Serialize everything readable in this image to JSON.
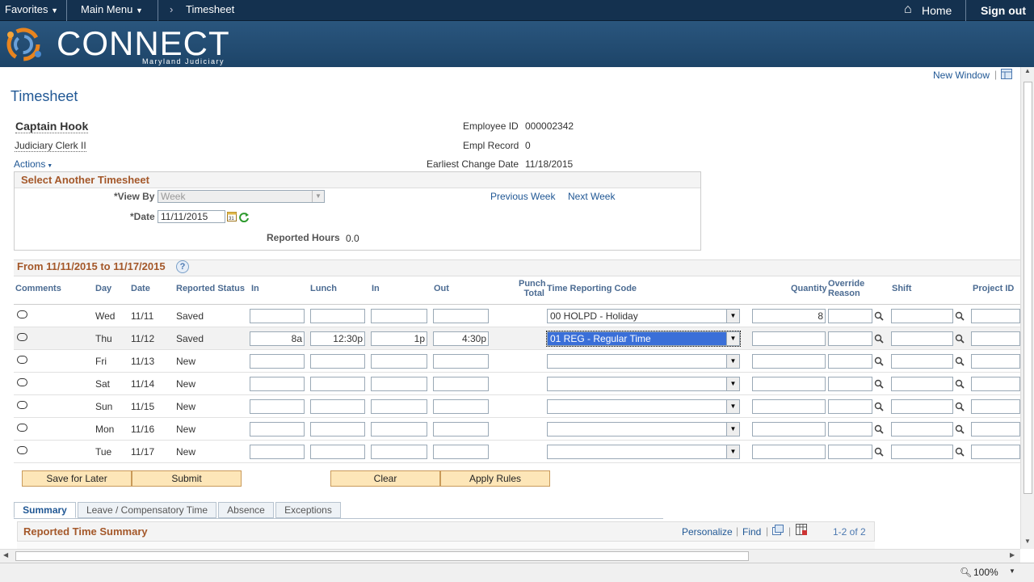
{
  "topnav": {
    "favorites": "Favorites",
    "main_menu": "Main Menu",
    "breadcrumb_current": "Timesheet",
    "home": "Home",
    "sign_out": "Sign out"
  },
  "banner": {
    "logo_title": "CONNECT",
    "logo_subtitle": "Maryland Judiciary"
  },
  "page": {
    "new_window": "New Window",
    "title": "Timesheet"
  },
  "employee": {
    "name": "Captain Hook",
    "job_title": "Judiciary Clerk II",
    "actions": "Actions",
    "employee_id_label": "Employee ID",
    "employee_id": "000002342",
    "empl_record_label": "Empl Record",
    "empl_record": "0",
    "earliest_change_label": "Earliest Change Date",
    "earliest_change": "11/18/2015"
  },
  "select_timesheet": {
    "header": "Select Another Timesheet",
    "view_by_label": "*View By",
    "view_by_value": "Week",
    "date_label": "*Date",
    "date_value": "11/11/2015",
    "previous_week": "Previous Week",
    "next_week": "Next Week",
    "reported_hours_label": "Reported Hours",
    "reported_hours": "0.0"
  },
  "grid": {
    "period": "From 11/11/2015 to 11/17/2015",
    "headers": {
      "comments": "Comments",
      "day": "Day",
      "date": "Date",
      "status": "Reported Status",
      "in1": "In",
      "lunch": "Lunch",
      "in2": "In",
      "out": "Out",
      "punch_total_1": "Punch",
      "punch_total_2": "Total",
      "trc": "Time Reporting Code",
      "quantity": "Quantity",
      "override_1": "Override",
      "override_2": "Reason",
      "shift": "Shift",
      "project": "Project ID"
    },
    "rows": [
      {
        "day": "Wed",
        "date": "11/11",
        "status": "Saved",
        "in1": "",
        "lunch": "",
        "in2": "",
        "out": "",
        "trc": "00 HOLPD - Holiday",
        "quantity": "8"
      },
      {
        "day": "Thu",
        "date": "11/12",
        "status": "Saved",
        "in1": "8a",
        "lunch": "12:30p",
        "in2": "1p",
        "out": "4:30p",
        "trc": "01 REG - Regular Time",
        "quantity": ""
      },
      {
        "day": "Fri",
        "date": "11/13",
        "status": "New",
        "in1": "",
        "lunch": "",
        "in2": "",
        "out": "",
        "trc": "",
        "quantity": ""
      },
      {
        "day": "Sat",
        "date": "11/14",
        "status": "New",
        "in1": "",
        "lunch": "",
        "in2": "",
        "out": "",
        "trc": "",
        "quantity": ""
      },
      {
        "day": "Sun",
        "date": "11/15",
        "status": "New",
        "in1": "",
        "lunch": "",
        "in2": "",
        "out": "",
        "trc": "",
        "quantity": ""
      },
      {
        "day": "Mon",
        "date": "11/16",
        "status": "New",
        "in1": "",
        "lunch": "",
        "in2": "",
        "out": "",
        "trc": "",
        "quantity": ""
      },
      {
        "day": "Tue",
        "date": "11/17",
        "status": "New",
        "in1": "",
        "lunch": "",
        "in2": "",
        "out": "",
        "trc": "",
        "quantity": ""
      }
    ]
  },
  "buttons": {
    "save_later": "Save for Later",
    "submit": "Submit",
    "clear": "Clear",
    "apply_rules": "Apply Rules"
  },
  "tabs": [
    "Summary",
    "Leave / Compensatory Time",
    "Absence",
    "Exceptions"
  ],
  "summary": {
    "header": "Reported Time Summary",
    "personalize": "Personalize",
    "find": "Find",
    "count": "1-2 of 2"
  },
  "status_bar": {
    "zoom": "100%"
  }
}
